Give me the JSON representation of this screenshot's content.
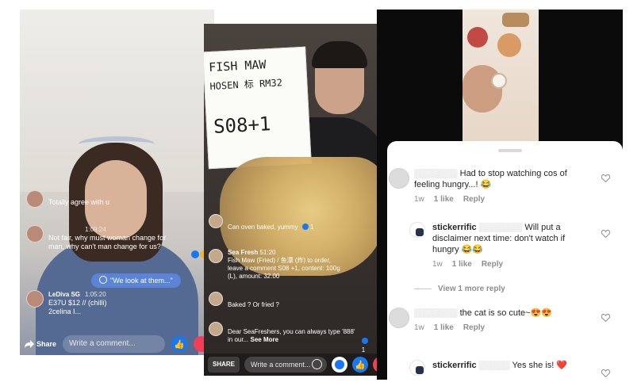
{
  "panel_left": {
    "comments": [
      {
        "name": "",
        "time": "",
        "text": "Totally agree with u"
      },
      {
        "name": "",
        "time": "1:09:24",
        "text": "Not fair, why must woman change for man, why can't man change for us?"
      },
      {
        "name": "LeDiva SG",
        "time": "1:05:20",
        "text": "E37U $12 // (chilli) 2celina I..."
      }
    ],
    "bubble_text": "\"We look at them...\"",
    "reaction_count": "5",
    "share_label": "Share",
    "comment_placeholder": "Write a comment..."
  },
  "panel_middle": {
    "board": {
      "line1": "FISH MAW",
      "line2": "HOSEN 标 RM32",
      "line3": "S08+1"
    },
    "comments": [
      {
        "name": "",
        "time": "",
        "text": "Can oven baked, yummy",
        "reactions": "1"
      },
      {
        "name": "Sea Fresh",
        "time": "51:20",
        "text": "Fish Maw (Fried) / 鱼漂 (炸) to order, leave a comment S08 +1, content: 100g (L), amount: 32.00"
      },
      {
        "name": "",
        "time": "",
        "text": "Baked ? Or fried ?"
      },
      {
        "name": "",
        "time": "",
        "text": "Dear SeaFreshers, you can always type '888' in our...",
        "more": "See More",
        "reactions": "1"
      }
    ],
    "share_label": "SHARE",
    "comment_placeholder": "Write a comment..."
  },
  "panel_right": {
    "comments": [
      {
        "user": "",
        "text": "Had to stop watching cos of feeling hungry...! 😂",
        "time": "1w",
        "likes": "1 like",
        "reply": "Reply"
      },
      {
        "user": "stickerrific",
        "text": "Will put a disclaimer next time: don't watch if hungry 😂😂",
        "time": "1w",
        "likes": "1 like",
        "reply": "Reply"
      },
      {
        "user": "",
        "text": "the cat is so cute~😍😍",
        "time": "1w",
        "likes": "1 like",
        "reply": "Reply"
      },
      {
        "user": "stickerrific",
        "text": "Yes she is! ❤️",
        "time": "",
        "likes": "",
        "reply": ""
      }
    ],
    "view_more_label": "View 1 more reply"
  },
  "colors": {
    "facebook_blue": "#1877f2",
    "love_red": "#f33e58",
    "meta_gray": "#8e8e8e"
  }
}
